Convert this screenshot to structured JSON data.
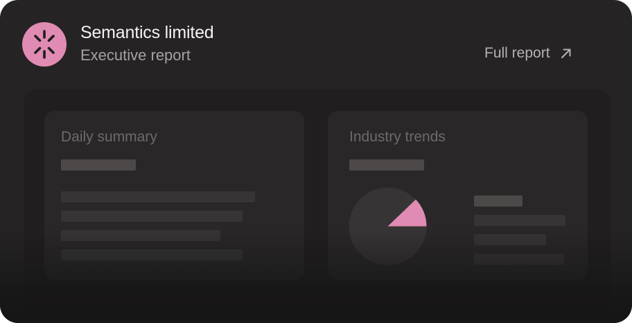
{
  "header": {
    "company_name": "Semantics limited",
    "subtitle": "Executive report",
    "logo_icon": "asterisk-spark-icon",
    "full_report_label": "Full report",
    "full_report_icon": "arrow-up-right-icon"
  },
  "widgets": [
    {
      "title": "Daily summary"
    },
    {
      "title": "Industry trends"
    }
  ],
  "colors": {
    "accent": "#e08bb3",
    "card_background": "#252323",
    "panel_background": "#201e1e",
    "widget_background": "#292727"
  }
}
